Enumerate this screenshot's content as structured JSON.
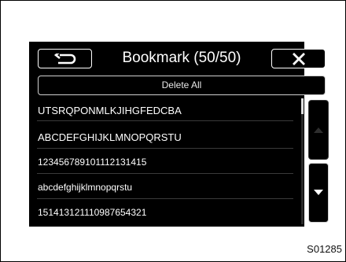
{
  "screen": {
    "title": "Bookmark (50/50)",
    "back_button": "back-icon",
    "close_button": "close-icon",
    "delete_all_label": "Delete All"
  },
  "bookmarks": [
    {
      "label": "UTSRQPONMLKJIHGFEDCBA"
    },
    {
      "label": "ABCDEFGHIJKLMNOPQRSTU"
    },
    {
      "label": "123456789101112131415"
    },
    {
      "label": "abcdefghijklmnopqrstu"
    },
    {
      "label": "151413121110987654321"
    }
  ],
  "figure_code": "S01285",
  "colors": {
    "screen_bg": "#000000",
    "text": "#ffffff",
    "button_border": "#ffffff"
  }
}
